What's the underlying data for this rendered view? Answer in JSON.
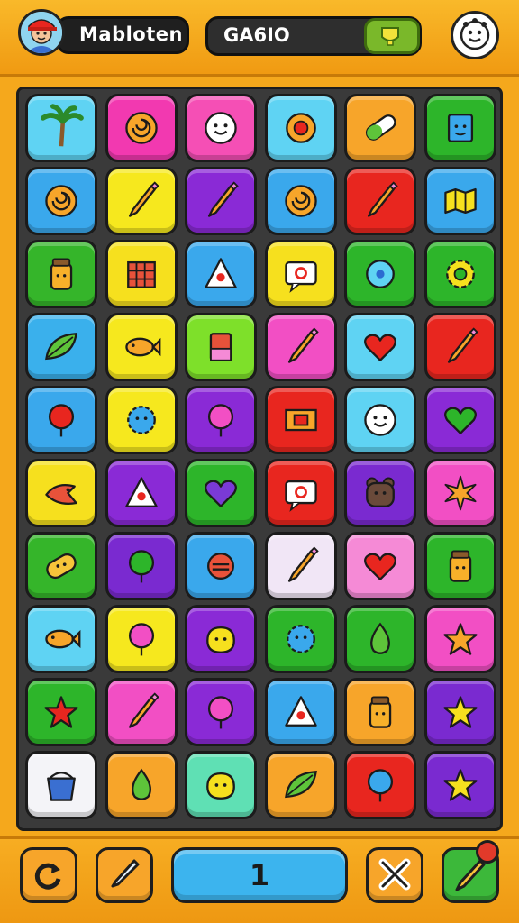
{
  "header": {
    "player_name": "Mabloten",
    "score_label": "GA6IO",
    "avatar_icon": "player-avatar",
    "badge_icon": "trophy-icon",
    "settings_icon": "face-icon"
  },
  "board": {
    "rows": 10,
    "cols": 6,
    "tiles": [
      [
        {
          "color": "#5fd3f3",
          "icon": "palm-tree"
        },
        {
          "color": "#f239b0",
          "icon": "swirl"
        },
        {
          "color": "#f54fb5",
          "icon": "face"
        },
        {
          "color": "#5fd3f3",
          "icon": "target"
        },
        {
          "color": "#f7a52a",
          "icon": "capsule"
        },
        {
          "color": "#2db52a",
          "icon": "cube-face"
        }
      ],
      [
        {
          "color": "#3aa8ec",
          "icon": "swirl"
        },
        {
          "color": "#f6e81e",
          "icon": "pencil"
        },
        {
          "color": "#8a2ad6",
          "icon": "pencil"
        },
        {
          "color": "#3aa8ec",
          "icon": "swirl"
        },
        {
          "color": "#e8261f",
          "icon": "pencil"
        },
        {
          "color": "#3aa8ec",
          "icon": "map"
        }
      ],
      [
        {
          "color": "#35b52a",
          "icon": "jar"
        },
        {
          "color": "#f6e01e",
          "icon": "crate"
        },
        {
          "color": "#3aa8ec",
          "icon": "triangle"
        },
        {
          "color": "#f6e01e",
          "icon": "speech"
        },
        {
          "color": "#2db52a",
          "icon": "gem"
        },
        {
          "color": "#2db52a",
          "icon": "gear"
        }
      ],
      [
        {
          "color": "#3ab0ec",
          "icon": "leaf"
        },
        {
          "color": "#f6e81e",
          "icon": "fish"
        },
        {
          "color": "#7ee02a",
          "icon": "cup"
        },
        {
          "color": "#f24fc4",
          "icon": "pencil"
        },
        {
          "color": "#5fd3f3",
          "icon": "heart"
        },
        {
          "color": "#e8261f",
          "icon": "pencil"
        }
      ],
      [
        {
          "color": "#3aa8ec",
          "icon": "balloon"
        },
        {
          "color": "#f6e81e",
          "icon": "flower"
        },
        {
          "color": "#8a2ad6",
          "icon": "balloon"
        },
        {
          "color": "#e8261f",
          "icon": "frame"
        },
        {
          "color": "#5fd3f3",
          "icon": "face"
        },
        {
          "color": "#8a2ad6",
          "icon": "heart"
        }
      ],
      [
        {
          "color": "#f6e01e",
          "icon": "bird"
        },
        {
          "color": "#8a2ad6",
          "icon": "triangle"
        },
        {
          "color": "#2db52a",
          "icon": "heart"
        },
        {
          "color": "#e8261f",
          "icon": "speech"
        },
        {
          "color": "#7a2ad0",
          "icon": "bear"
        },
        {
          "color": "#f24fc4",
          "icon": "burst"
        }
      ],
      [
        {
          "color": "#35b52a",
          "icon": "bread"
        },
        {
          "color": "#7a2ad0",
          "icon": "balloon"
        },
        {
          "color": "#3aa8ec",
          "icon": "ball"
        },
        {
          "color": "#f1e6f6",
          "icon": "pencil"
        },
        {
          "color": "#f58ad6",
          "icon": "heart"
        },
        {
          "color": "#2db52a",
          "icon": "jar"
        }
      ],
      [
        {
          "color": "#5fd3f3",
          "icon": "fish"
        },
        {
          "color": "#f6e81e",
          "icon": "balloon"
        },
        {
          "color": "#8a2ad6",
          "icon": "blob"
        },
        {
          "color": "#2db52a",
          "icon": "flower"
        },
        {
          "color": "#2db52a",
          "icon": "drop"
        },
        {
          "color": "#f24fc4",
          "icon": "star"
        }
      ],
      [
        {
          "color": "#2db52a",
          "icon": "star"
        },
        {
          "color": "#f24fc4",
          "icon": "pencil"
        },
        {
          "color": "#8a2ad6",
          "icon": "balloon"
        },
        {
          "color": "#3aa8ec",
          "icon": "triangle"
        },
        {
          "color": "#f7a52a",
          "icon": "jar"
        },
        {
          "color": "#7a2ad0",
          "icon": "star"
        }
      ],
      [
        {
          "color": "#f4f4f8",
          "icon": "bucket"
        },
        {
          "color": "#f7a52a",
          "icon": "drop"
        },
        {
          "color": "#5fe0b4",
          "icon": "blob"
        },
        {
          "color": "#f7a52a",
          "icon": "leaf"
        },
        {
          "color": "#e8261f",
          "icon": "balloon"
        },
        {
          "color": "#7a2ad0",
          "icon": "star"
        }
      ]
    ]
  },
  "footer": {
    "level": "1",
    "buttons": [
      "refresh-icon",
      "brush-icon",
      "close-icon",
      "edit-icon"
    ],
    "notification_color": "#e23a2a"
  }
}
